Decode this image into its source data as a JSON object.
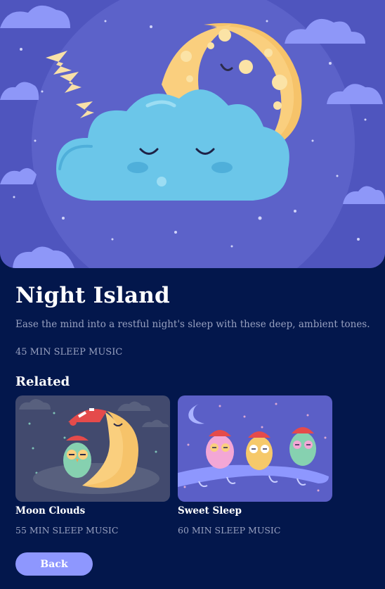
{
  "track": {
    "title": "Night Island",
    "description": "Ease the mind into a restful night's sleep with these deep, ambient tones.",
    "meta": "45 MIN SLEEP MUSIC",
    "illustration": "sleeping-cloud-and-moon"
  },
  "related": {
    "heading": "Related",
    "items": [
      {
        "title": "Moon Clouds",
        "meta": "55 MIN SLEEP MUSIC",
        "illustration": "owl-on-crescent-moon"
      },
      {
        "title": "Sweet Sleep",
        "meta": "60 MIN SLEEP MUSIC",
        "illustration": "three-owls-on-branch"
      }
    ]
  },
  "back_button": {
    "label": "Back"
  },
  "colors": {
    "background": "#03174C",
    "accent": "#8E97FE",
    "hero_background": "#4F55BE",
    "muted_text": "#98A1C0"
  }
}
